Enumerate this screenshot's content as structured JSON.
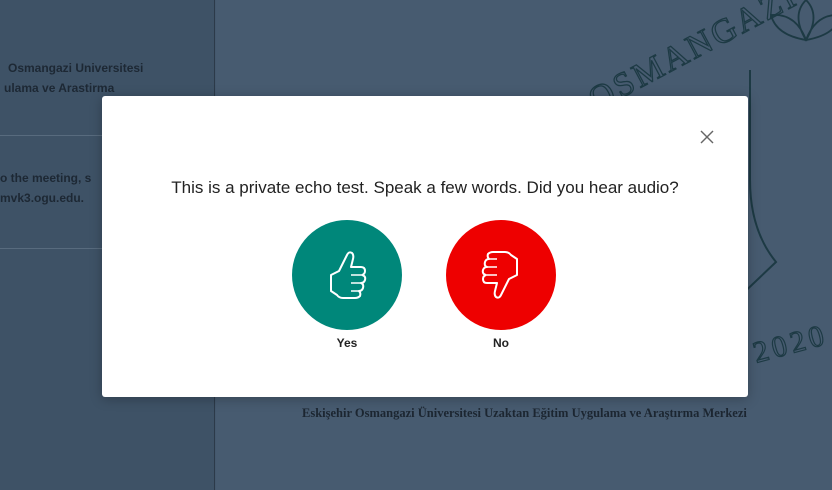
{
  "background": {
    "left_panel": {
      "item1_lines": [
        "Osmangazi Universitesi",
        "ulama ve Arastirma"
      ],
      "item2_lines": [
        "o the meeting, s",
        "mvk3.ogu.edu."
      ]
    },
    "presentation": {
      "logo_arc_text": "OSMANGAZI",
      "year_text": "2020",
      "caption": "Eskişehir Osmangazi Üniversitesi Uzaktan Eğitim Uygulama ve Araştırma Merkezi"
    }
  },
  "modal": {
    "title": "This is a private echo test. Speak a few words. Did you hear audio?",
    "yes_label": "Yes",
    "no_label": "No",
    "close_icon": "close-icon",
    "colors": {
      "yes": "#00877a",
      "no": "#ee0000",
      "overlay": "#3d5166"
    }
  }
}
